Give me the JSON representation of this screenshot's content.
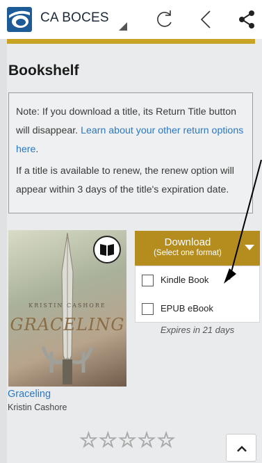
{
  "appbar": {
    "title": "CA BOCES",
    "icons": [
      "overdrive-logo-icon",
      "refresh-icon",
      "back-chevron-icon",
      "share-icon"
    ]
  },
  "page": {
    "title": "Bookshelf"
  },
  "note": {
    "line1_text": "Note: If you download a title, its Return Title button will disappear. ",
    "line1_link": "Learn about your other return options here",
    "line1_end": ".",
    "line2": "If a title is available to renew, the renew option will appear within 3 days of the title's expiration date."
  },
  "book": {
    "cover_author": "KRISTIN CASHORE",
    "cover_title": "GRACELING",
    "title": "Graceling",
    "author": "Kristin Cashore",
    "read_icon": "book-open-icon"
  },
  "download": {
    "label": "Download",
    "sublabel": "(Select one format)",
    "options": [
      {
        "label": "Kindle Book",
        "checked": false
      },
      {
        "label": "EPUB eBook",
        "checked": false
      }
    ],
    "expires": "Expires in 21 days"
  },
  "rating": {
    "stars": "☆☆☆☆☆",
    "value": 0,
    "max": 5
  },
  "colors": {
    "accent_gold": "#c8a326",
    "download_gold": "#b48d1e",
    "link_blue": "#2b77c2",
    "logo_blue": "#1d5b97"
  }
}
